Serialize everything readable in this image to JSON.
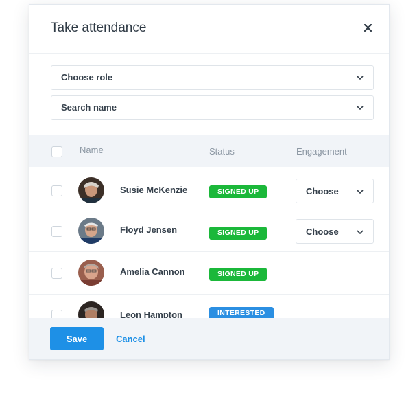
{
  "modal": {
    "title": "Take attendance",
    "close_icon": "close-icon"
  },
  "filters": {
    "role_select": "Choose role",
    "name_search": "Search name"
  },
  "table": {
    "columns": [
      "Name",
      "Status",
      "Engagement"
    ],
    "rows": [
      {
        "name": "Susie McKenzie",
        "status": "SIGNED UP",
        "status_color": "#1bb83a",
        "engagement": "Choose"
      },
      {
        "name": "Floyd Jensen",
        "status": "SIGNED UP",
        "status_color": "#1bb83a",
        "engagement": "Choose"
      },
      {
        "name": "Amelia Cannon",
        "status": "SIGNED UP",
        "status_color": "#1bb83a",
        "engagement": ""
      },
      {
        "name": "Leon Hampton",
        "status": "INTERESTED",
        "status_color": "#2b8fe2",
        "engagement": ""
      }
    ]
  },
  "footer": {
    "save_label": "Save",
    "cancel_label": "Cancel"
  },
  "colors": {
    "accent": "#1e90e6",
    "signed_up": "#1bb83a",
    "interested": "#2b8fe2"
  }
}
